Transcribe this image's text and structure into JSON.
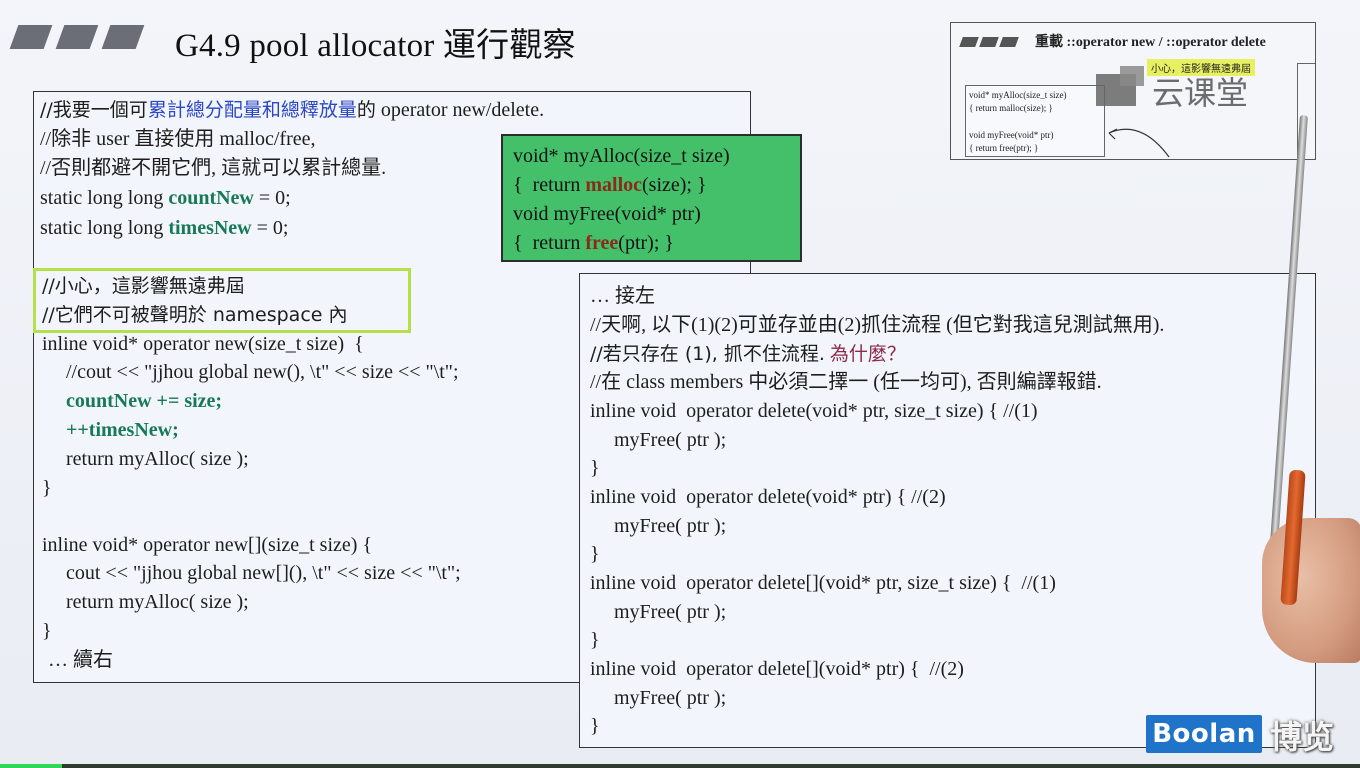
{
  "header": {
    "title": "G4.9 pool allocator 運行觀察"
  },
  "left_panel": {
    "lines": [
      "//我要一個可累計總分配量和總釋放量的 operator new/delete.",
      "//除非 user 直接使用 malloc/free,",
      "//否則都避不開它們, 這就可以累計總量.",
      "static long long countNew = 0;",
      "static long long timesNew = 0;",
      "//小心，這影響無遠弗屆",
      "//它們不可被聲明於 namespace 內",
      "inline void* operator new(size_t size)  {",
      "//cout << \"jjhou global new(), \\t\" << size << \"\\t\";",
      "countNew += size;",
      "++timesNew;",
      "return myAlloc( size );",
      "}",
      "inline void* operator new[](size_t size) {",
      "cout << \"jjhou global new[](), \\t\" << size << \"\\t\";",
      "return myAlloc( size );",
      "}",
      "… 續右"
    ],
    "highlight_blue": "累計總分配量和總釋放量",
    "highlight_green_count": "countNew",
    "highlight_green_times": "timesNew"
  },
  "green_box": {
    "lines": [
      "void* myAlloc(size_t size)",
      "{  return malloc(size); }",
      "void myFree(void* ptr)",
      "{  return free(ptr); }"
    ],
    "red_malloc": "malloc",
    "red_free": "free"
  },
  "right_panel": {
    "lines": [
      "… 接左",
      "//天啊, 以下(1)(2)可並存並由(2)抓住流程 (但它對我這兒測試無用).",
      "//若只存在 (1), 抓不住流程. 為什麼？",
      "//在 class members 中必須二擇一 (任一均可), 否則編譯報錯.",
      "inline void  operator delete(void* ptr, size_t size) { //(1)",
      "myFree( ptr );",
      "}",
      "inline void  operator delete(void* ptr) { //(2)",
      "myFree( ptr );",
      "}",
      "inline void  operator delete[](void* ptr, size_t size) {  //(1)",
      "myFree( ptr );",
      "}",
      "inline void  operator delete[](void* ptr) {  //(2)",
      "myFree( ptr );",
      "}"
    ],
    "why_text": "為什麼？"
  },
  "thumbnail": {
    "title": "重載 ::operator new / ::operator delete",
    "tag": "小心，這影響無遠弗屆",
    "code_lines": [
      "void* myAlloc(size_t size)",
      "{  return malloc(size); }",
      "void myFree(void* ptr)",
      "{  return free(ptr); }"
    ]
  },
  "watermark": {
    "cloud_text": "云课堂",
    "boolan_text": "Boolan",
    "boolan_cn": "博览"
  },
  "colors": {
    "accent_blue": "#2b47c4",
    "accent_green": "#177a55",
    "green_box": "#44c06b",
    "yellow_outline": "#b5e04a",
    "boolan_blue": "#1f74c9"
  }
}
